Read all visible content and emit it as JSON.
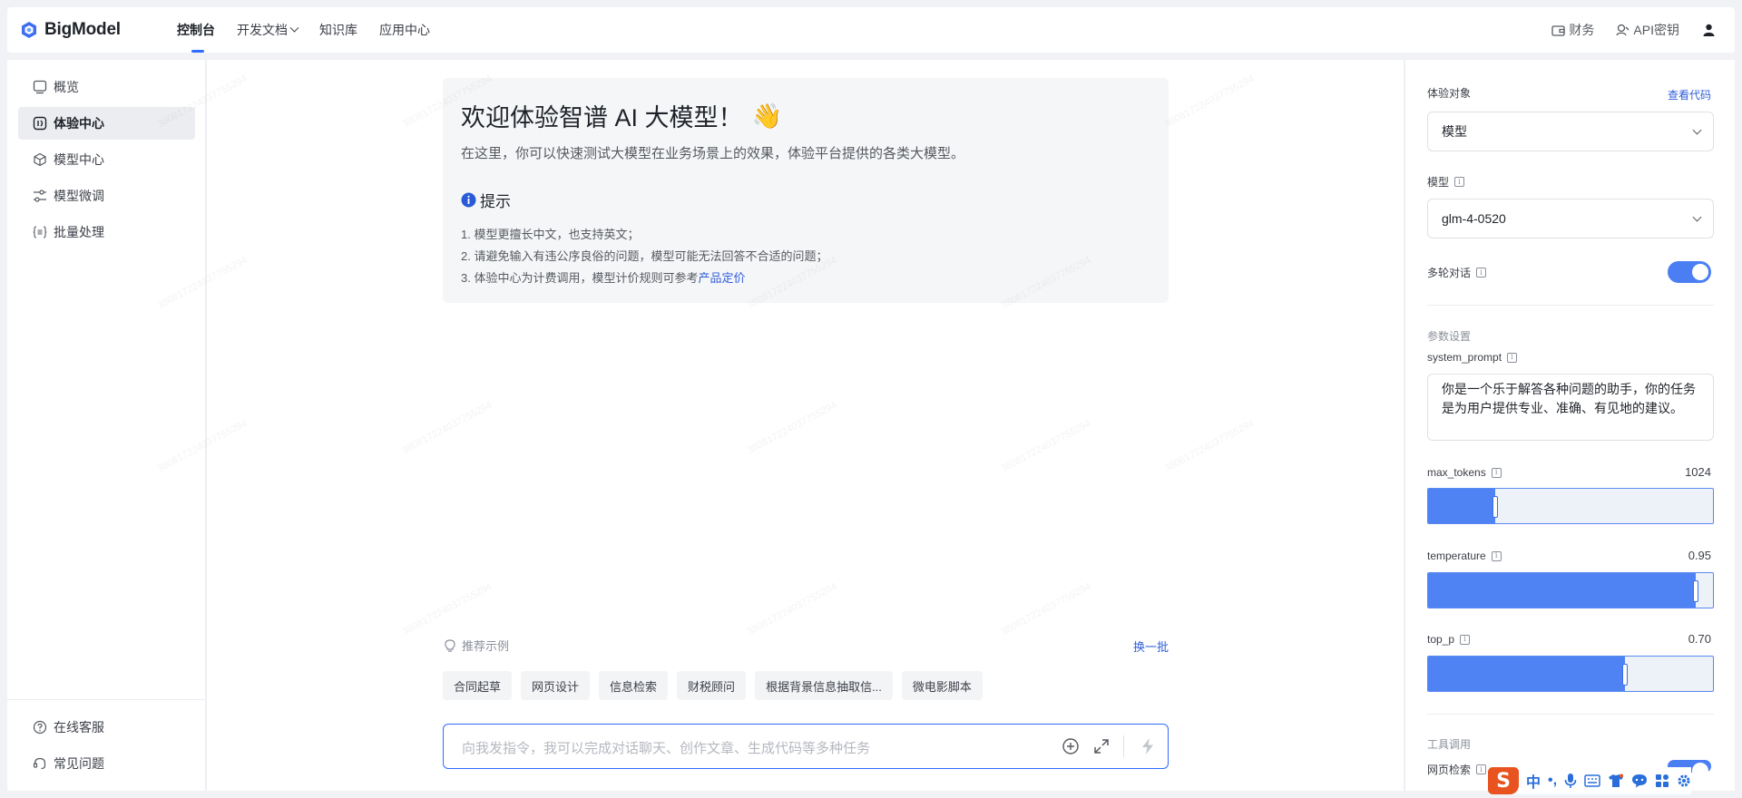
{
  "brand": {
    "name": "BigModel",
    "color": "#2f6bff"
  },
  "nav": {
    "items": [
      {
        "label": "控制台",
        "active": true
      },
      {
        "label": "开发文档",
        "has_dropdown": true
      },
      {
        "label": "知识库"
      },
      {
        "label": "应用中心"
      }
    ]
  },
  "topright": {
    "finance": "财务",
    "api_key": "API密钥",
    "user_icon": "user-icon"
  },
  "sidebar": {
    "items": [
      {
        "label": "概览",
        "icon": "monitor-icon"
      },
      {
        "label": "体验中心",
        "icon": "experience-icon",
        "active": true
      },
      {
        "label": "模型中心",
        "icon": "cube-icon"
      },
      {
        "label": "模型微调",
        "icon": "sliders-icon"
      },
      {
        "label": "批量处理",
        "icon": "braces-icon"
      }
    ],
    "bottom": [
      {
        "label": "在线客服",
        "icon": "help-circle-icon"
      },
      {
        "label": "常见问题",
        "icon": "headset-icon"
      }
    ]
  },
  "welcome": {
    "title": "欢迎体验智谱 AI 大模型！",
    "emoji": "👋",
    "subtitle": "在这里，你可以快速测试大模型在业务场景上的效果，体验平台提供的各类大模型。",
    "tip_title": "提示",
    "tips": [
      "1. 模型更擅长中文，也支持英文；",
      "2. 请避免输入有违公序良俗的问题，模型可能无法回答不合适的问题；",
      "3. 体验中心为计费调用，模型计价规则可参考"
    ],
    "tip_link": "产品定价"
  },
  "recommend": {
    "label": "推荐示例",
    "refresh": "换一批",
    "chips": [
      "合同起草",
      "网页设计",
      "信息检索",
      "财税顾问",
      "根据背景信息抽取信...",
      "微电影脚本"
    ]
  },
  "input": {
    "placeholder": "向我发指令，我可以完成对话聊天、创作文章、生成代码等多种任务"
  },
  "panel": {
    "target_label": "体验对象",
    "view_code": "查看代码",
    "target_value": "模型",
    "model_label": "模型",
    "model_value": "glm-4-0520",
    "multi_turn_label": "多轮对话",
    "multi_turn_on": true,
    "params_title": "参数设置",
    "system_prompt_label": "system_prompt",
    "system_prompt_value": "你是一个乐于解答各种问题的助手，你的任务是为用户提供专业、准确、有见地的建议。",
    "max_tokens_label": "max_tokens",
    "max_tokens_value": "1024",
    "max_tokens_fraction": 0.235,
    "temperature_label": "temperature",
    "temperature_value": "0.95",
    "temperature_fraction": 0.94,
    "top_p_label": "top_p",
    "top_p_value": "0.70",
    "top_p_fraction": 0.69,
    "tools_title": "工具调用",
    "web_search_label": "网页检索",
    "web_search_on": true
  },
  "ime": {
    "logo": "S",
    "lang": "中",
    "punct": "•,",
    "icons": [
      "mic-icon",
      "keyboard-icon",
      "skin-icon",
      "chat-icon",
      "grid-icon",
      "gear-icon"
    ]
  },
  "watermark": "380817224037755294"
}
